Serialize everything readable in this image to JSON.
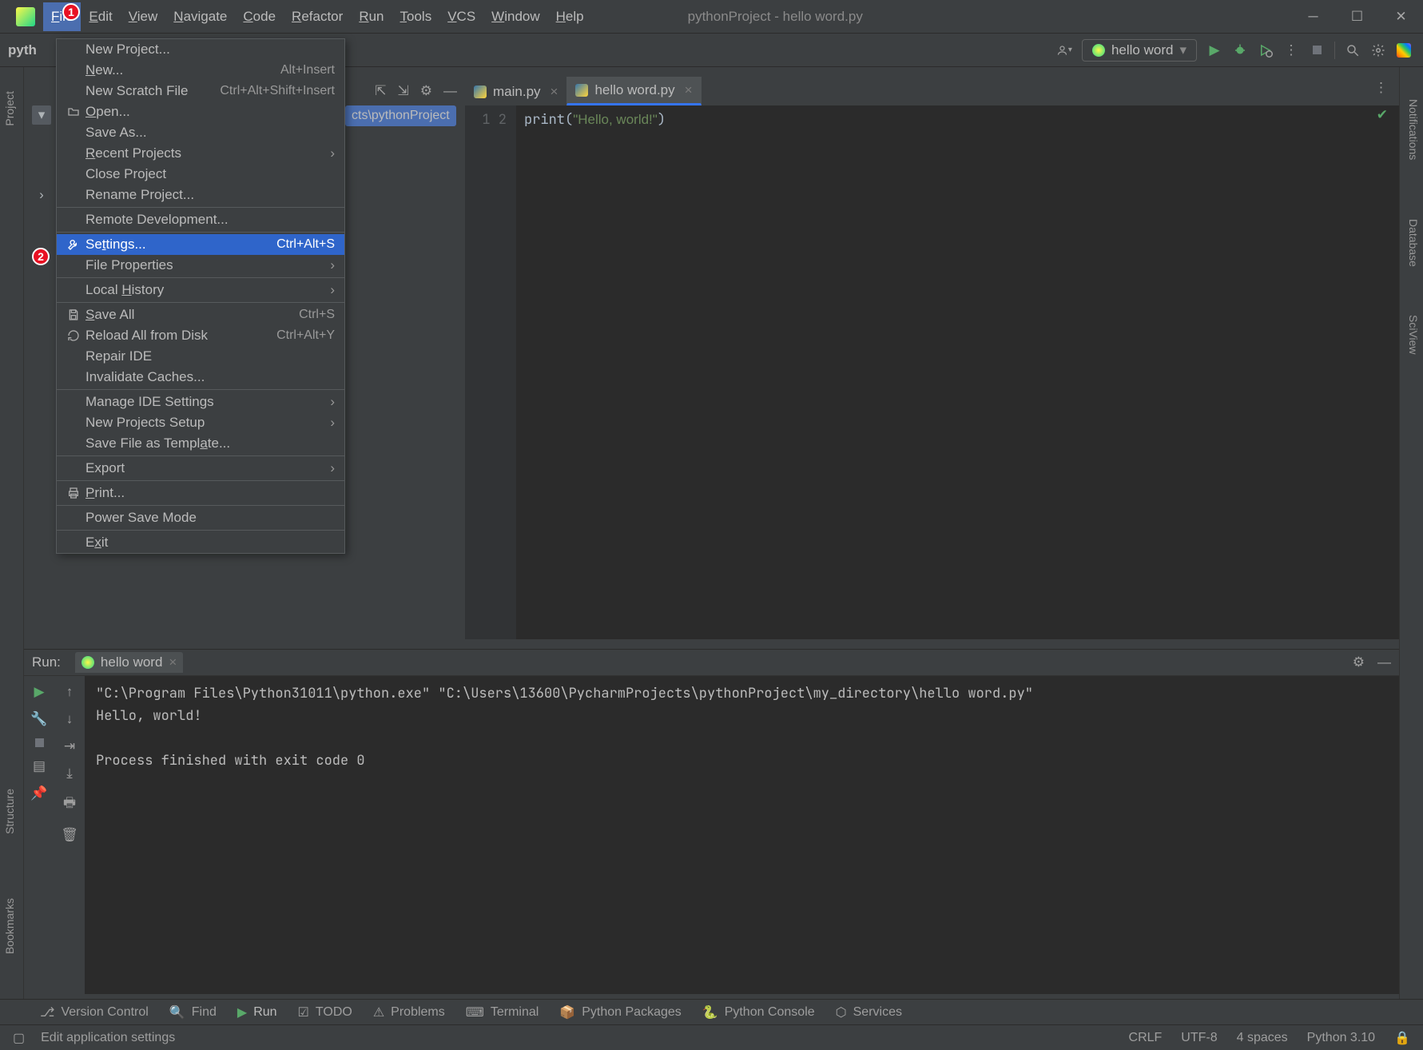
{
  "window": {
    "title": "pythonProject - hello word.py"
  },
  "menubar": [
    "File",
    "Edit",
    "View",
    "Navigate",
    "Code",
    "Refactor",
    "Run",
    "Tools",
    "VCS",
    "Window",
    "Help"
  ],
  "menubar_active_index": 0,
  "annotations": {
    "a1": "1",
    "a2": "2"
  },
  "file_menu": {
    "groups": [
      [
        {
          "label": "New Project...",
          "icon": "",
          "shortcut": "",
          "submenu": false
        },
        {
          "label_html": "<span class='mn'>N</span>ew...",
          "label": "New...",
          "icon": "",
          "shortcut": "Alt+Insert",
          "submenu": false
        },
        {
          "label": "New Scratch File",
          "icon": "",
          "shortcut": "Ctrl+Alt+Shift+Insert",
          "submenu": false
        },
        {
          "label_html": "<span class='mn'>O</span>pen...",
          "label": "Open...",
          "icon": "folder",
          "shortcut": "",
          "submenu": false
        },
        {
          "label": "Save As...",
          "icon": "",
          "shortcut": "",
          "submenu": false
        },
        {
          "label_html": "<span class='mn'>R</span>ecent Projects",
          "label": "Recent Projects",
          "icon": "",
          "shortcut": "",
          "submenu": true
        },
        {
          "label_html": "Close Pro<span class='mn'>j</span>ect",
          "label": "Close Project",
          "icon": "",
          "shortcut": "",
          "submenu": false
        },
        {
          "label": "Rename Project...",
          "icon": "",
          "shortcut": "",
          "submenu": false
        }
      ],
      [
        {
          "label": "Remote Development...",
          "icon": "",
          "shortcut": "",
          "submenu": false
        }
      ],
      [
        {
          "label_html": "Se<span class='mn'>t</span>tings...",
          "label": "Settings...",
          "icon": "wrench",
          "shortcut": "Ctrl+Alt+S",
          "submenu": false,
          "highlight": true
        },
        {
          "label": "File Properties",
          "icon": "",
          "shortcut": "",
          "submenu": true
        }
      ],
      [
        {
          "label_html": "Local <span class='mn'>H</span>istory",
          "label": "Local History",
          "icon": "",
          "shortcut": "",
          "submenu": true
        }
      ],
      [
        {
          "label_html": "<span class='mn'>S</span>ave All",
          "label": "Save All",
          "icon": "save",
          "shortcut": "Ctrl+S",
          "submenu": false
        },
        {
          "label": "Reload All from Disk",
          "icon": "reload",
          "shortcut": "Ctrl+Alt+Y",
          "submenu": false
        },
        {
          "label": "Repair IDE",
          "icon": "",
          "shortcut": "",
          "submenu": false
        },
        {
          "label": "Invalidate Caches...",
          "icon": "",
          "shortcut": "",
          "submenu": false
        }
      ],
      [
        {
          "label": "Manage IDE Settings",
          "icon": "",
          "shortcut": "",
          "submenu": true
        },
        {
          "label": "New Projects Setup",
          "icon": "",
          "shortcut": "",
          "submenu": true
        },
        {
          "label_html": "Save File as Templ<span class='mn'>a</span>te...",
          "label": "Save File as Template...",
          "icon": "",
          "shortcut": "",
          "submenu": false
        }
      ],
      [
        {
          "label": "Export",
          "icon": "",
          "shortcut": "",
          "submenu": true
        }
      ],
      [
        {
          "label_html": "<span class='mn'>P</span>rint...",
          "label": "Print...",
          "icon": "print",
          "shortcut": "",
          "submenu": false
        }
      ],
      [
        {
          "label": "Power Save Mode",
          "icon": "",
          "shortcut": "",
          "submenu": false
        }
      ],
      [
        {
          "label_html": "E<span class='mn'>x</span>it",
          "label": "Exit",
          "icon": "",
          "shortcut": "",
          "submenu": false
        }
      ]
    ]
  },
  "project_label": "pyth",
  "breadcrumb": "cts\\pythonProject",
  "run_config": {
    "name": "hello word"
  },
  "editor_tabs": [
    {
      "name": "main.py",
      "active": false
    },
    {
      "name": "hello word.py",
      "active": true
    }
  ],
  "editor": {
    "lines": [
      {
        "num": "1",
        "code_html": "print(<span class='s-str'>\"Hello, world!\"</span>)"
      },
      {
        "num": "2",
        "code_html": ""
      }
    ]
  },
  "left_rail": {
    "project": "Project",
    "structure": "Structure",
    "bookmarks": "Bookmarks"
  },
  "right_rail": {
    "notifications": "Notifications",
    "database": "Database",
    "sciview": "SciView"
  },
  "run_panel": {
    "title": "Run:",
    "tab": "hello word",
    "console_text": "\"C:\\Program Files\\Python31011\\python.exe\" \"C:\\Users\\13600\\PycharmProjects\\pythonProject\\my_directory\\hello word.py\"\nHello, world!\n\nProcess finished with exit code 0\n"
  },
  "bottom_bar": {
    "version_control": "Version Control",
    "find": "Find",
    "run": "Run",
    "todo": "TODO",
    "problems": "Problems",
    "terminal": "Terminal",
    "py_packages": "Python Packages",
    "py_console": "Python Console",
    "services": "Services"
  },
  "status_bar": {
    "message": "Edit application settings",
    "line_sep": "CRLF",
    "encoding": "UTF-8",
    "indent": "4 spaces",
    "interpreter": "Python 3.10"
  }
}
